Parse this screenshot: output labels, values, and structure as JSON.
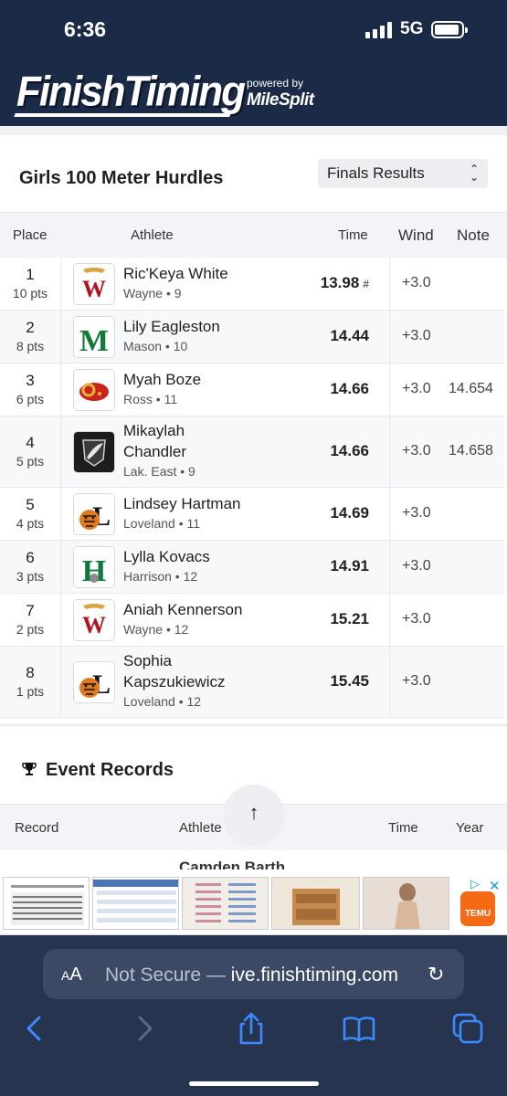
{
  "status_bar": {
    "time": "6:36",
    "network": "5G"
  },
  "header": {
    "logo_text": "FinishTiming",
    "powered_by": "powered by",
    "partner": "MileSplit"
  },
  "event": {
    "title": "Girls 100 Meter Hurdles",
    "round_selected": "Finals Results",
    "columns": {
      "place": "Place",
      "athlete": "Athlete",
      "time": "Time",
      "wind": "Wind",
      "note": "Note"
    },
    "results": [
      {
        "place": "1",
        "pts": "10 pts",
        "name": "Ric'Keya White",
        "team": "Wayne • 9",
        "time": "13.98",
        "flag": "#",
        "wind": "+3.0",
        "note": "",
        "logo": "wayne-logo"
      },
      {
        "place": "2",
        "pts": "8 pts",
        "name": "Lily Eagleston",
        "team": "Mason • 10",
        "time": "14.44",
        "flag": "",
        "wind": "+3.0",
        "note": "",
        "logo": "mason-logo"
      },
      {
        "place": "3",
        "pts": "6 pts",
        "name": "Myah Boze",
        "team": "Ross • 11",
        "time": "14.66",
        "flag": "",
        "wind": "+3.0",
        "note": "14.654",
        "logo": "ross-logo"
      },
      {
        "place": "4",
        "pts": "5 pts",
        "name": "Mikaylah Chandler",
        "team": "Lak. East • 9",
        "time": "14.66",
        "flag": "",
        "wind": "+3.0",
        "note": "14.658",
        "logo": "lakota-east-logo"
      },
      {
        "place": "5",
        "pts": "4 pts",
        "name": "Lindsey Hartman",
        "team": "Loveland • 11",
        "time": "14.69",
        "flag": "",
        "wind": "+3.0",
        "note": "",
        "logo": "loveland-logo"
      },
      {
        "place": "6",
        "pts": "3 pts",
        "name": "Lylla Kovacs",
        "team": "Harrison • 12",
        "time": "14.91",
        "flag": "",
        "wind": "+3.0",
        "note": "",
        "logo": "harrison-logo"
      },
      {
        "place": "7",
        "pts": "2 pts",
        "name": "Aniah Kennerson",
        "team": "Wayne • 12",
        "time": "15.21",
        "flag": "",
        "wind": "+3.0",
        "note": "",
        "logo": "wayne-logo"
      },
      {
        "place": "8",
        "pts": "1 pts",
        "name": "Sophia Kapszukiewicz",
        "team": "Loveland • 12",
        "time": "15.45",
        "flag": "",
        "wind": "+3.0",
        "note": "",
        "logo": "loveland-logo"
      }
    ]
  },
  "records": {
    "title": "Event Records",
    "columns": {
      "record": "Record",
      "athlete": "Athlete",
      "time": "Time",
      "year": "Year"
    },
    "first_row_partial": "Camden Barth"
  },
  "scroll_top": "↑",
  "ad": {
    "brand": "TEMU"
  },
  "browser": {
    "aa": "AA",
    "security": "Not Secure —",
    "url": "ive.finishtiming.com"
  }
}
